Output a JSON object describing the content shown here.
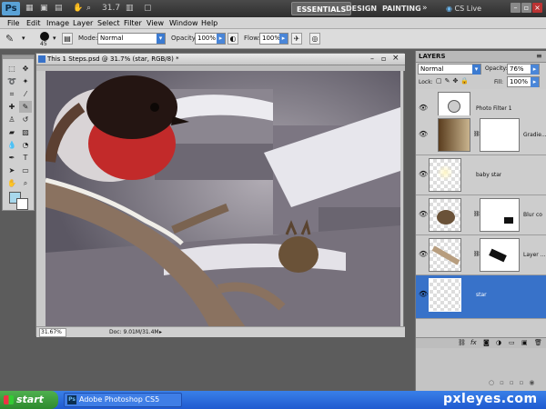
{
  "app_bar": {
    "logo": "Ps",
    "zoom": "31.7",
    "workspaces": [
      "ESSENTIALS",
      "DESIGN",
      "PAINTING"
    ],
    "more": "»",
    "cs_live": "CS Live"
  },
  "menu": [
    "File",
    "Edit",
    "Image",
    "Layer",
    "Select",
    "Filter",
    "View",
    "Window",
    "Help"
  ],
  "options_bar": {
    "brush_size": "45",
    "mode_label": "Mode:",
    "mode_value": "Normal",
    "opacity_label": "Opacity:",
    "opacity_value": "100%",
    "flow_label": "Flow:",
    "flow_value": "100%"
  },
  "document": {
    "title": "This 1 Steps.psd @ 31.7% (star, RGB/8) *",
    "zoom_status": "31.67%",
    "doc_size": "Doc: 9.01M/31.4M"
  },
  "layers_panel": {
    "tab": "LAYERS",
    "blend_mode": "Normal",
    "opacity_label": "Opacity:",
    "opacity_value": "76%",
    "lock_label": "Lock:",
    "fill_label": "Fill:",
    "fill_value": "100%",
    "layers": [
      {
        "name": "Photo Filter 1",
        "selected": false
      },
      {
        "name": "Gradie...",
        "selected": false
      },
      {
        "name": "baby star",
        "selected": false
      },
      {
        "name": "Blur co",
        "selected": false
      },
      {
        "name": "Layer ...",
        "selected": false
      },
      {
        "name": "star",
        "selected": true
      }
    ]
  },
  "taskbar": {
    "start": "start",
    "task_icon": "Ps",
    "task": "Adobe Photoshop CS5"
  },
  "watermark": "pxleyes.com",
  "colors": {
    "foreground": "#a8d8ec",
    "background": "#ffffff",
    "selection": "#3872c9"
  }
}
